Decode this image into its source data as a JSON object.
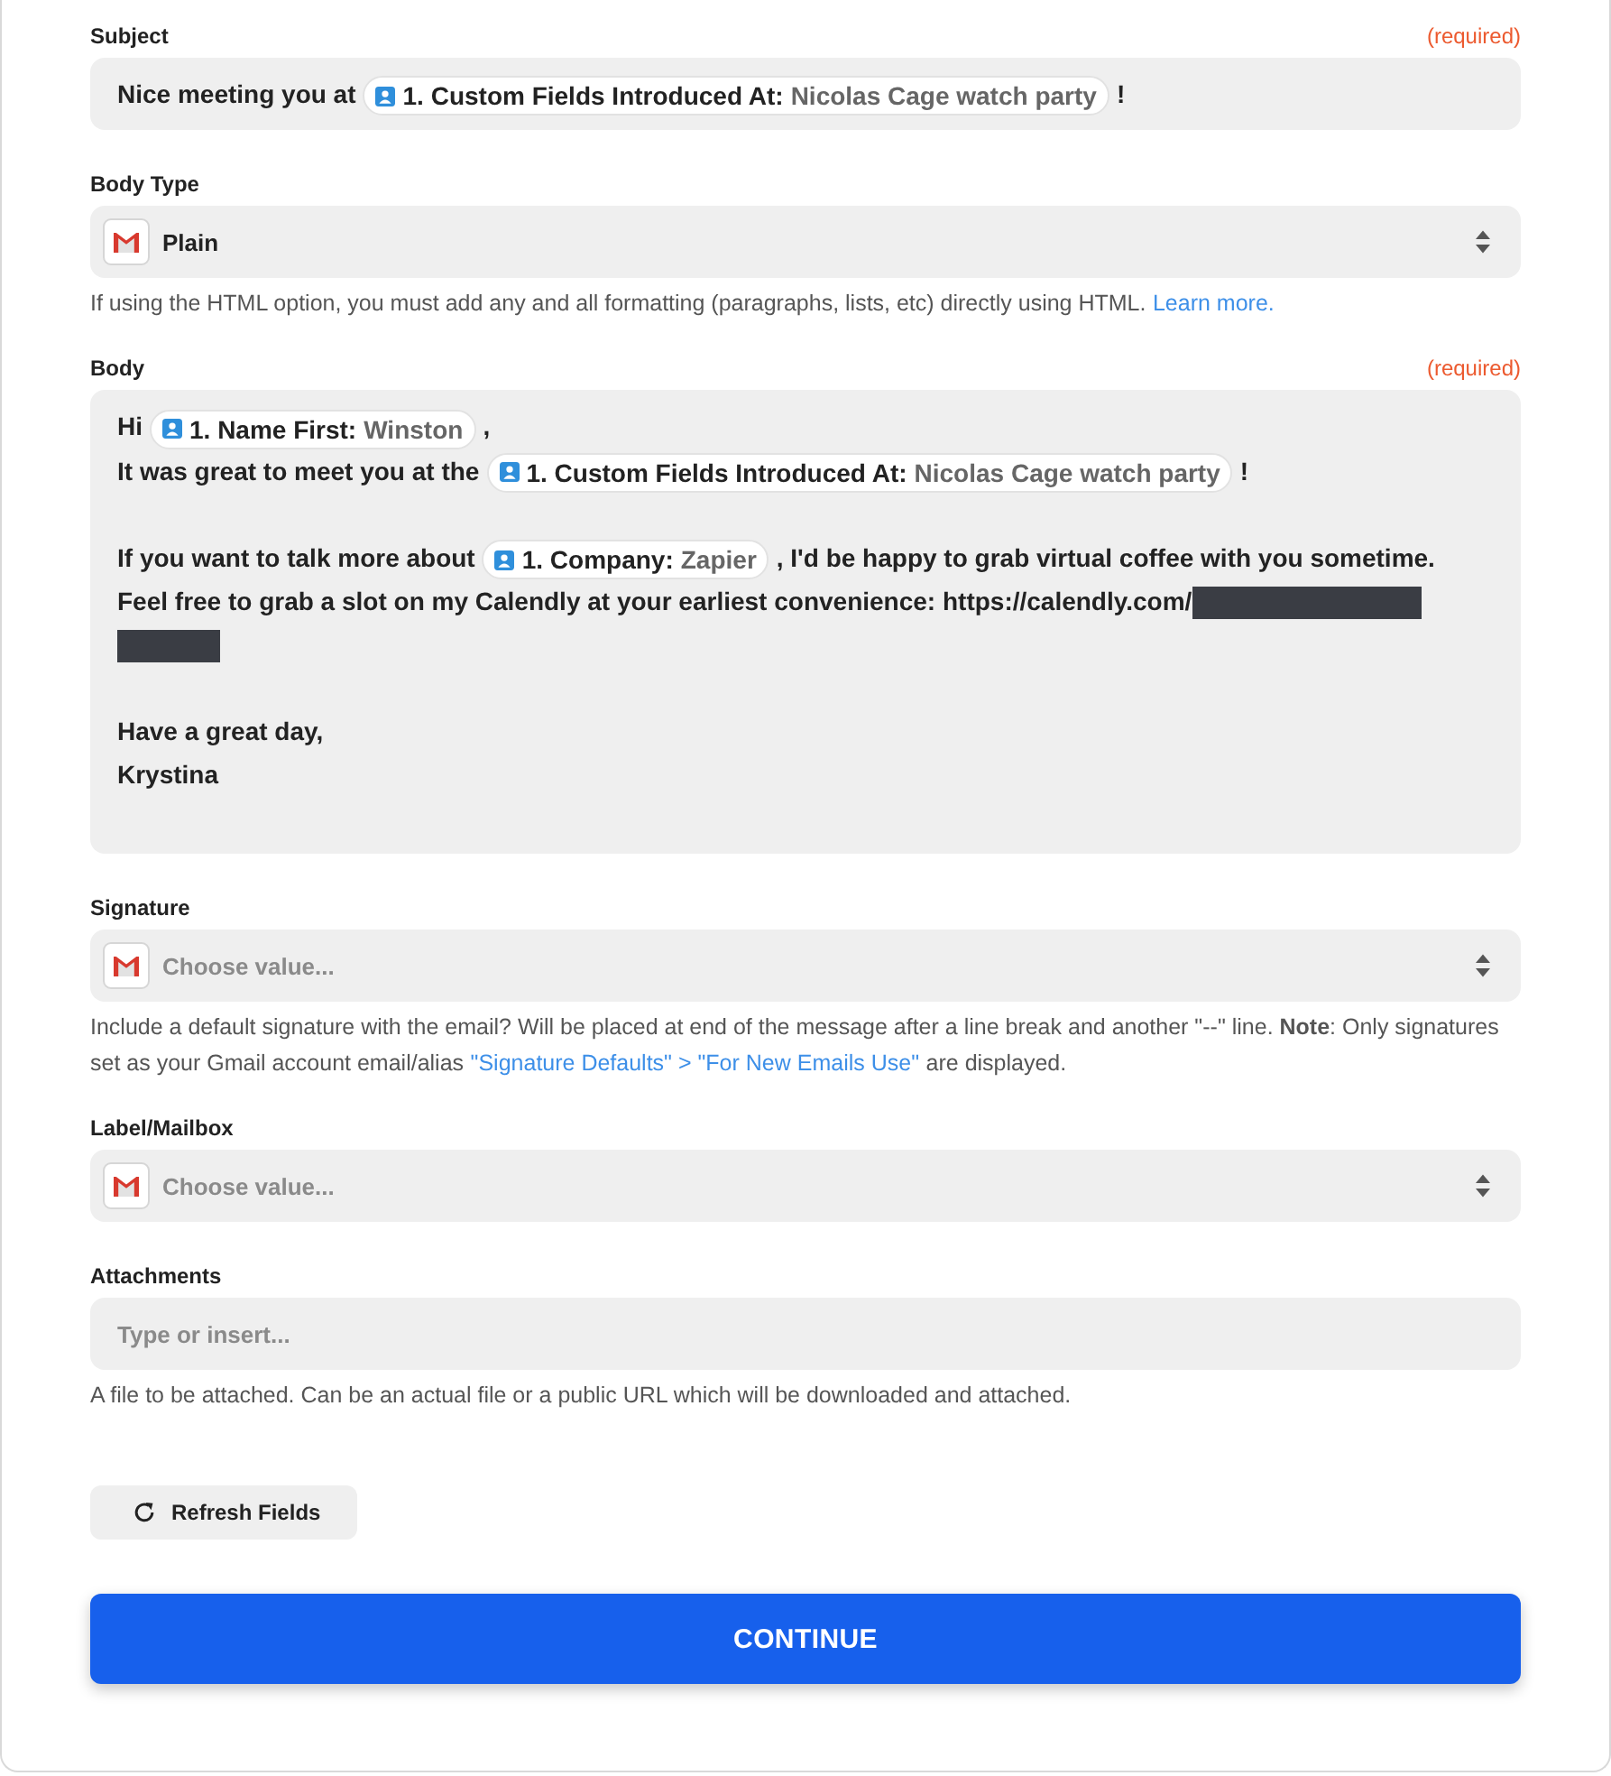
{
  "fields": [
    {
      "kind": "tokens",
      "label": "Subject",
      "required": "(required)",
      "segments": [
        {
          "kind": "text",
          "text": "Nice meeting you at"
        },
        {
          "kind": "token",
          "label": "1. Custom Fields Introduced At:",
          "value": "Nicolas Cage watch party"
        },
        {
          "kind": "text",
          "text": "!"
        }
      ]
    },
    {
      "kind": "select",
      "label": "Body Type",
      "value": "Plain",
      "help": [
        {
          "kind": "text",
          "text": "If using the HTML option, you must add any and all formatting (paragraphs, lists, etc) directly using HTML."
        },
        {
          "kind": "link",
          "text": "Learn more."
        }
      ]
    },
    {
      "kind": "richtext",
      "label": "Body",
      "required": "(required)",
      "lines": [
        {
          "kind": "text",
          "segments": [
            {
              "kind": "text",
              "text": "Hi"
            },
            {
              "kind": "token",
              "label": "1. Name First:",
              "value": "Winston"
            },
            {
              "kind": "text",
              "text": ","
            }
          ]
        },
        {
          "kind": "text",
          "segments": [
            {
              "kind": "text",
              "text": "It was great to meet you at the"
            },
            {
              "kind": "token",
              "label": "1. Custom Fields Introduced At:",
              "value": "Nicolas Cage watch party"
            },
            {
              "kind": "text",
              "text": "!"
            }
          ]
        },
        {
          "kind": "blank"
        },
        {
          "kind": "text",
          "segments": [
            {
              "kind": "text",
              "text": "If you want to talk more about"
            },
            {
              "kind": "token",
              "label": "1. Company:",
              "value": "Zapier"
            },
            {
              "kind": "text",
              "text": ", I'd be happy to grab virtual coffee with you sometime."
            }
          ]
        },
        {
          "kind": "text",
          "segments": [
            {
              "kind": "text",
              "text": "Feel free to grab a slot on my Calendly at your earliest convenience: https://calendly.com/"
            },
            {
              "kind": "redacted"
            }
          ]
        },
        {
          "kind": "text",
          "segments": [
            {
              "kind": "redacted"
            }
          ]
        },
        {
          "kind": "blank"
        },
        {
          "kind": "text",
          "segments": [
            {
              "kind": "text",
              "text": "Have a great day,"
            }
          ]
        },
        {
          "kind": "text",
          "segments": [
            {
              "kind": "text",
              "text": "Krystina"
            }
          ]
        }
      ]
    },
    {
      "kind": "select",
      "label": "Signature",
      "placeholder": "Choose value...",
      "help": [
        {
          "kind": "text",
          "text": "Include a default signature with the email? Will be placed at end of the message after a line break and another \"--\" line. **Note**: Only signatures set as your Gmail account email/alias"
        },
        {
          "kind": "link",
          "text": "\"Signature Defaults\" > \"For New Emails Use\""
        },
        {
          "kind": "text",
          "text": "are displayed."
        }
      ]
    },
    {
      "kind": "select",
      "label": "Label/Mailbox",
      "placeholder": "Choose value..."
    },
    {
      "kind": "input",
      "label": "Attachments",
      "placeholder": "Type or insert...",
      "help": [
        {
          "kind": "text",
          "text": "A file to be attached. Can be an actual file or a public URL which will be downloaded and attached."
        }
      ]
    }
  ],
  "refresh_button": {
    "label": "Refresh Fields"
  },
  "continue_button": {
    "label": "CONTINUE"
  }
}
